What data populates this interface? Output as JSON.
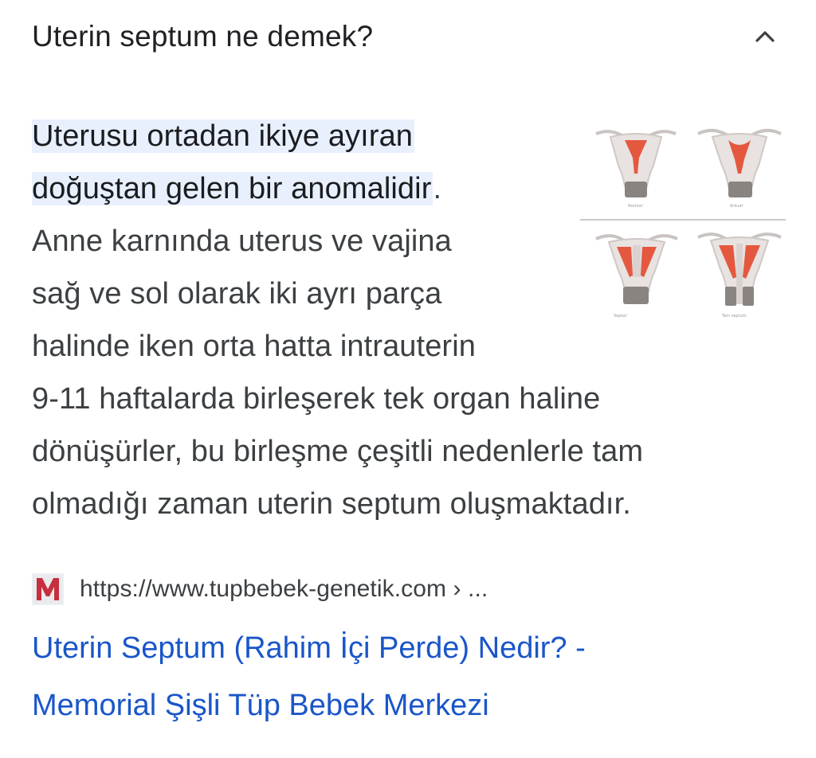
{
  "question": {
    "text": "Uterin septum ne demek?",
    "icon": "chevron-up-icon"
  },
  "answer": {
    "highlight_line1": "Uterusu ortadan ikiye ayıran",
    "highlight_line2": "doğuştan gelen bir anomalidir",
    "highlight_period": ".",
    "lines": [
      "Anne karnında uterus ve vajina",
      "sağ ve sol olarak iki ayrı parça",
      "halinde iken orta hatta intrauterin",
      "9-11 haftalarda birleşerek tek organ haline",
      "dönüşürler, bu birleşme çeşitli nedenlerle tam",
      "olmadığı zaman uterin septum oluşmaktadır."
    ],
    "highlight_color": "#e8f0fe"
  },
  "source": {
    "favicon_letter": "M",
    "favicon_color": "#c62f3e",
    "url": "https://www.tupbebek-genetik.com › ..."
  },
  "result": {
    "title_line1": "Uterin Septum (Rahim İçi Perde) Nedir? -",
    "title_line2": "Memorial Şişli Tüp Bebek Merkezi",
    "link_color": "#1a56c9"
  }
}
